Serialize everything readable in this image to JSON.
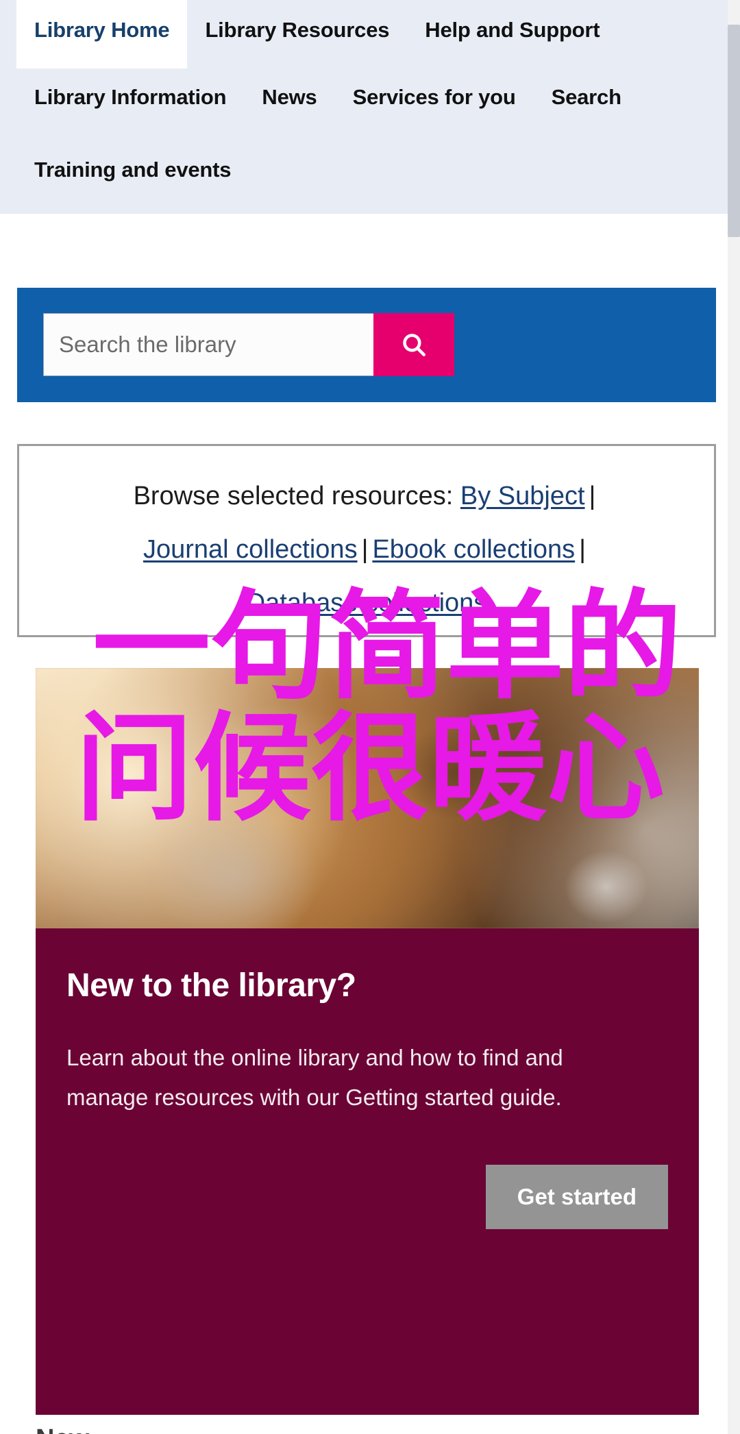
{
  "nav": {
    "rows": [
      [
        {
          "label": "Library Home",
          "active": true
        },
        {
          "label": "Library Resources",
          "active": false
        },
        {
          "label": "Help and Support",
          "active": false
        }
      ],
      [
        {
          "label": "Library Information",
          "active": false
        },
        {
          "label": "News",
          "active": false
        },
        {
          "label": "Services for you",
          "active": false
        },
        {
          "label": "Search",
          "active": false
        }
      ],
      [
        {
          "label": "Training and events",
          "active": false
        }
      ]
    ]
  },
  "search": {
    "placeholder": "Search the library",
    "value": "",
    "button_icon": "search-icon",
    "panel_color": "#0f5faa",
    "button_color": "#e6006e"
  },
  "browse": {
    "intro": "Browse selected resources:",
    "links": [
      "By Subject",
      "Journal collections",
      "Ebook collections",
      "Database collections"
    ],
    "separator": "|",
    "link_color": "#1a3f73"
  },
  "hero": {
    "alt": "Smiling woman with curly hair holding a phone outdoors"
  },
  "card": {
    "title": "New to the library?",
    "body": "Learn about the online library and how to find and manage resources with our Getting started guide.",
    "button_label": "Get started",
    "background_color": "#6b0434",
    "button_color": "#949494"
  },
  "watermark": {
    "line1": "一句简单的",
    "line2": "问候很暖心",
    "color": "#e619e6"
  },
  "bottom_partial": {
    "text": "New"
  }
}
